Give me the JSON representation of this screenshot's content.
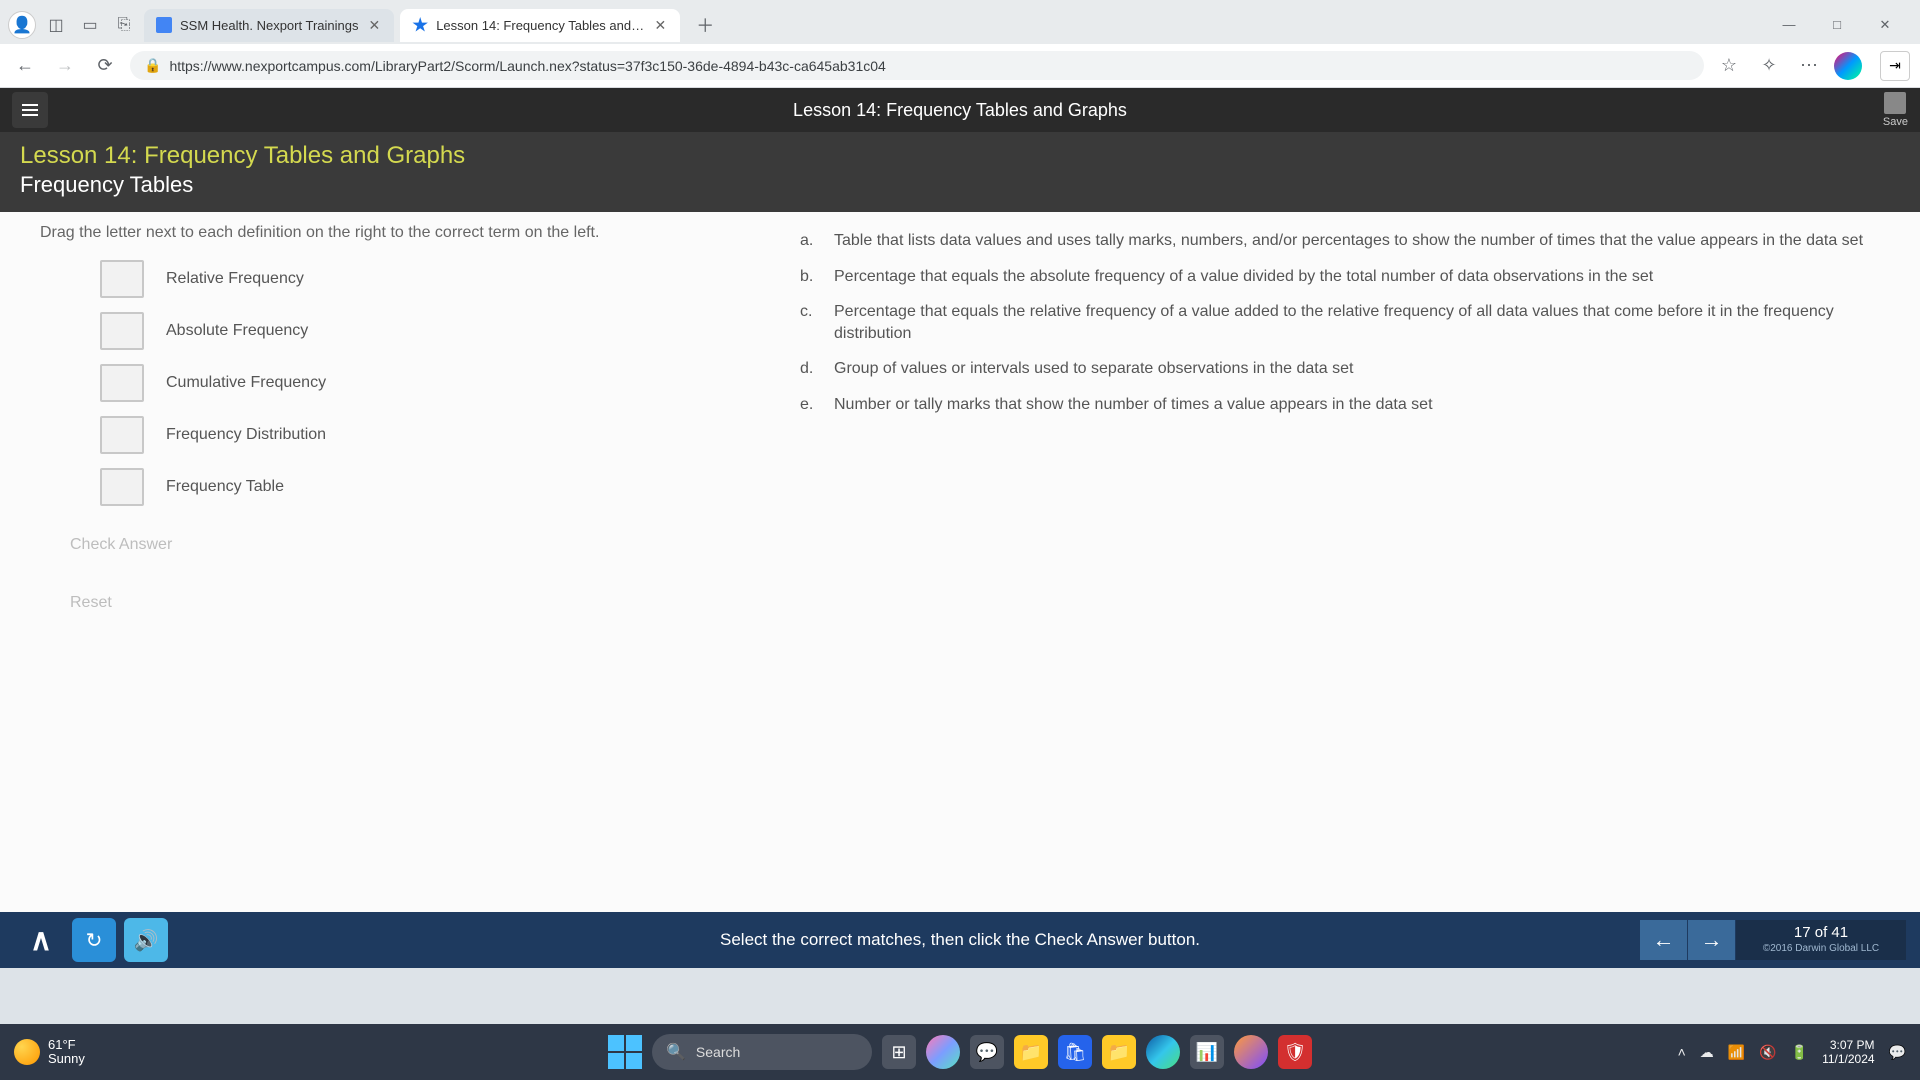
{
  "browser": {
    "tabs": [
      {
        "title": "SSM Health. Nexport Trainings"
      },
      {
        "title": "Lesson 14: Frequency Tables and G"
      }
    ],
    "url": "https://www.nexportcampus.com/LibraryPart2/Scorm/Launch.nex?status=37f3c150-36de-4894-b43c-ca645ab31c04"
  },
  "course": {
    "top_title": "Lesson 14: Frequency Tables and Graphs",
    "save_label": "Save",
    "lesson_title": "Lesson 14: Frequency Tables and Graphs",
    "subtitle": "Frequency Tables",
    "instruction": "Drag the letter next to each definition on the right to the correct term on the left.",
    "terms": [
      "Relative Frequency",
      "Absolute Frequency",
      "Cumulative Frequency",
      "Frequency Distribution",
      "Frequency Table"
    ],
    "definitions": [
      {
        "letter": "a.",
        "text": "Table that lists data values and uses tally marks, numbers, and/or percentages to show the number of times that the value appears in the data set"
      },
      {
        "letter": "b.",
        "text": "Percentage that equals the absolute frequency of a value divided by the total number of data observations in the set"
      },
      {
        "letter": "c.",
        "text": "Percentage that equals the relative frequency of a value added to the relative frequency of all data values that come before it in the frequency distribution"
      },
      {
        "letter": "d.",
        "text": "Group of values or intervals used to separate observations in the data set"
      },
      {
        "letter": "e.",
        "text": "Number or tally marks that show the number of times a value appears in the data set"
      }
    ],
    "check_label": "Check Answer",
    "reset_label": "Reset",
    "footer_instruction": "Select the correct matches, then click the Check Answer button.",
    "page_indicator": "17 of 41",
    "copyright": "©2016 Darwin Global LLC"
  },
  "taskbar": {
    "temp": "61°F",
    "condition": "Sunny",
    "search_placeholder": "Search",
    "time": "3:07 PM",
    "date": "11/1/2024"
  }
}
